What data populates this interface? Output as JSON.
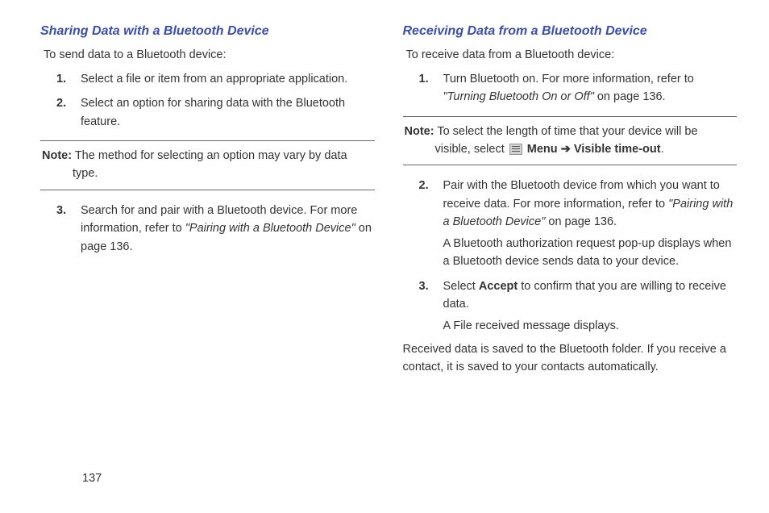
{
  "left": {
    "heading": "Sharing Data with a Bluetooth Device",
    "intro": "To send data to a Bluetooth device:",
    "step1": "Select a file or item from an appropriate application.",
    "step2": "Select an option for sharing data with the Bluetooth feature.",
    "noteLabel": "Note:",
    "noteBody": " The method for selecting an option may vary by data type.",
    "step3a": "Search for and pair with a Bluetooth device. For more information, refer to ",
    "step3Ref": "\"Pairing with a Bluetooth Device\"",
    "step3b": " on page 136."
  },
  "right": {
    "heading": "Receiving Data from a Bluetooth Device",
    "intro": "To receive data from a Bluetooth device:",
    "step1a": "Turn Bluetooth on. For more information, refer to ",
    "step1Ref": "\"Turning Bluetooth On or Off\"",
    "step1b": "  on page 136.",
    "noteLabel": "Note:",
    "noteBody1": " To select the length of time that your device will be visible, select ",
    "menuLabel": " Menu ",
    "arrow": "➔",
    "visibleTimeout": " Visible time-out",
    "period": ".",
    "step2a": "Pair with the Bluetooth device from which you want to receive data. For more information, refer to ",
    "step2Ref": "\"Pairing with a Bluetooth Device\"",
    "step2b": "  on page 136.",
    "step2Sub": "A Bluetooth authorization request pop-up displays when a Bluetooth device sends data to your device.",
    "step3a": "Select ",
    "step3Bold": "Accept",
    "step3b": " to confirm that you are willing to receive data.",
    "step3Sub": "A File received message displays.",
    "closing": "Received data is saved to the Bluetooth folder. If you receive a contact, it is saved to your contacts automatically."
  },
  "pageNumber": "137"
}
